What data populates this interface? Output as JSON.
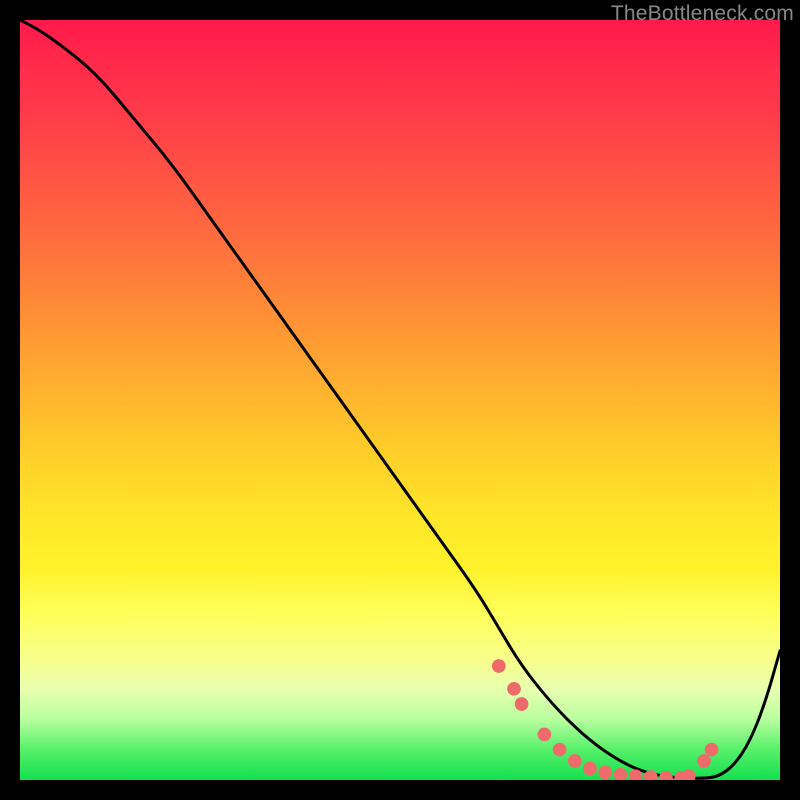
{
  "watermark": "TheBottleneck.com",
  "chart_data": {
    "type": "line",
    "title": "",
    "xlabel": "",
    "ylabel": "",
    "xlim": [
      0,
      100
    ],
    "ylim": [
      0,
      100
    ],
    "grid": false,
    "legend": false,
    "series": [
      {
        "name": "curve",
        "color": "#000000",
        "x": [
          0,
          2,
          5,
          10,
          15,
          20,
          25,
          30,
          35,
          40,
          45,
          50,
          55,
          60,
          63,
          66,
          70,
          74,
          78,
          82,
          86,
          90,
          92,
          94,
          96,
          98,
          100
        ],
        "y": [
          100,
          99,
          97,
          93,
          87,
          81,
          74,
          67,
          60,
          53,
          46,
          39,
          32,
          25,
          20,
          15,
          10,
          6,
          3,
          1,
          0.3,
          0.2,
          0.5,
          2,
          5,
          10,
          17
        ]
      }
    ],
    "markers": {
      "name": "flat-region-dots",
      "color": "#ef6b6b",
      "radius_pct": 0.9,
      "x": [
        63,
        65,
        66,
        69,
        71,
        73,
        75,
        77,
        79,
        81,
        83,
        85,
        87,
        88,
        90,
        91
      ],
      "y": [
        15,
        12,
        10,
        6,
        4,
        2.5,
        1.5,
        1.0,
        0.7,
        0.5,
        0.4,
        0.3,
        0.3,
        0.5,
        2.5,
        4.0
      ]
    }
  }
}
